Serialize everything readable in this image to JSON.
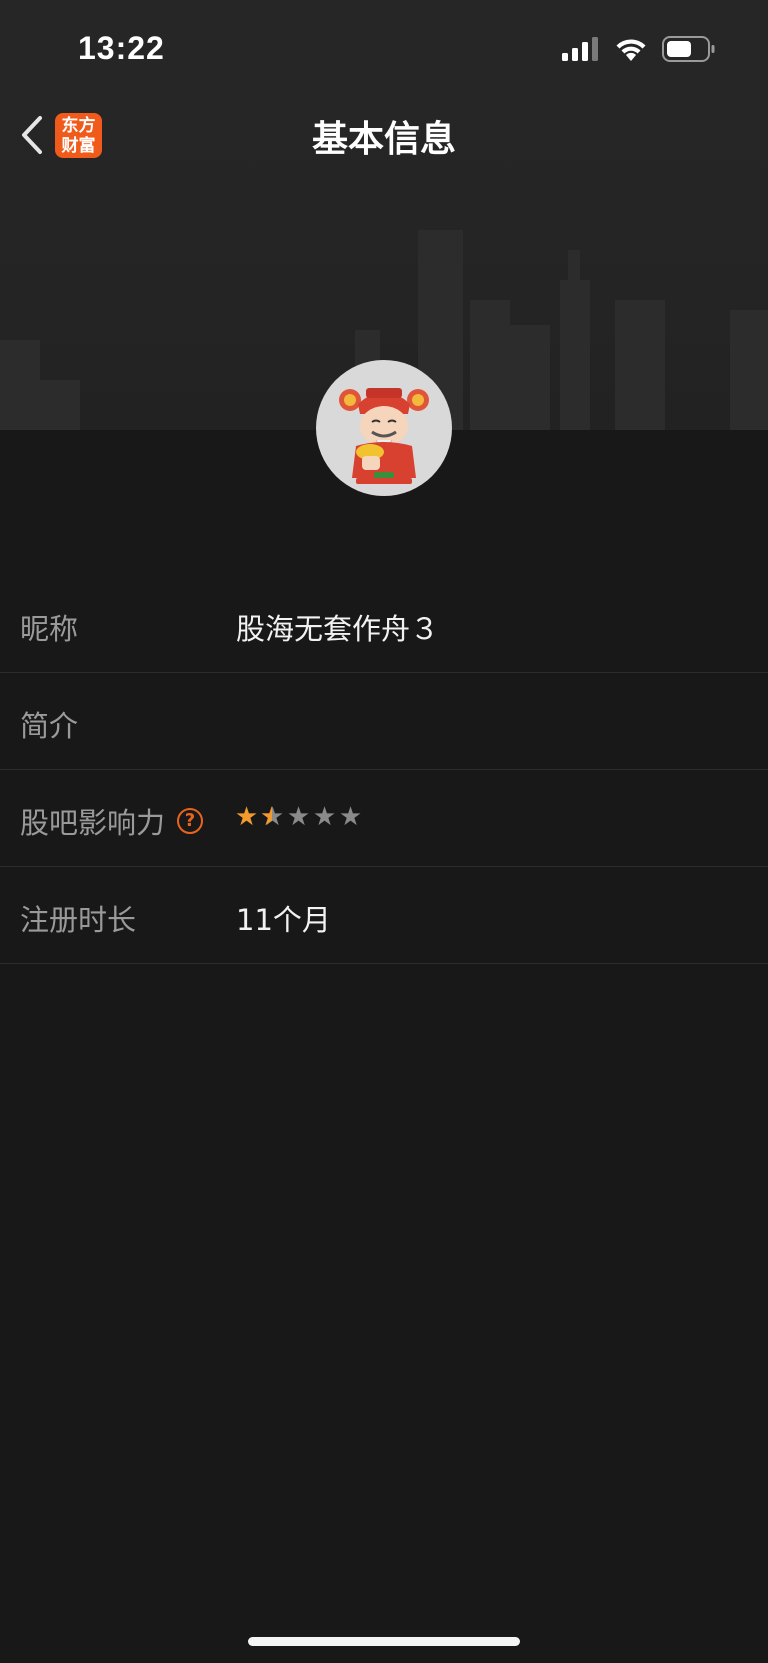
{
  "status_bar": {
    "time": "13:22"
  },
  "nav": {
    "title": "基本信息",
    "logo_line1": "东方",
    "logo_line2": "财富"
  },
  "profile": {
    "rows": [
      {
        "label": "昵称",
        "value": "股海无套作舟３"
      },
      {
        "label": "简介",
        "value": ""
      },
      {
        "label": "股吧影响力",
        "help_icon": "?",
        "rating": 1.5,
        "rating_max": 5
      },
      {
        "label": "注册时长",
        "value": "11个月"
      }
    ]
  },
  "colors": {
    "accent": "#f05a1a",
    "star_on": "#f29a2e",
    "star_off": "#8a8a8a",
    "background": "#181818"
  },
  "icons": [
    "back-chevron-icon",
    "signal-icon",
    "wifi-icon",
    "battery-icon",
    "help-icon",
    "star-icon"
  ]
}
